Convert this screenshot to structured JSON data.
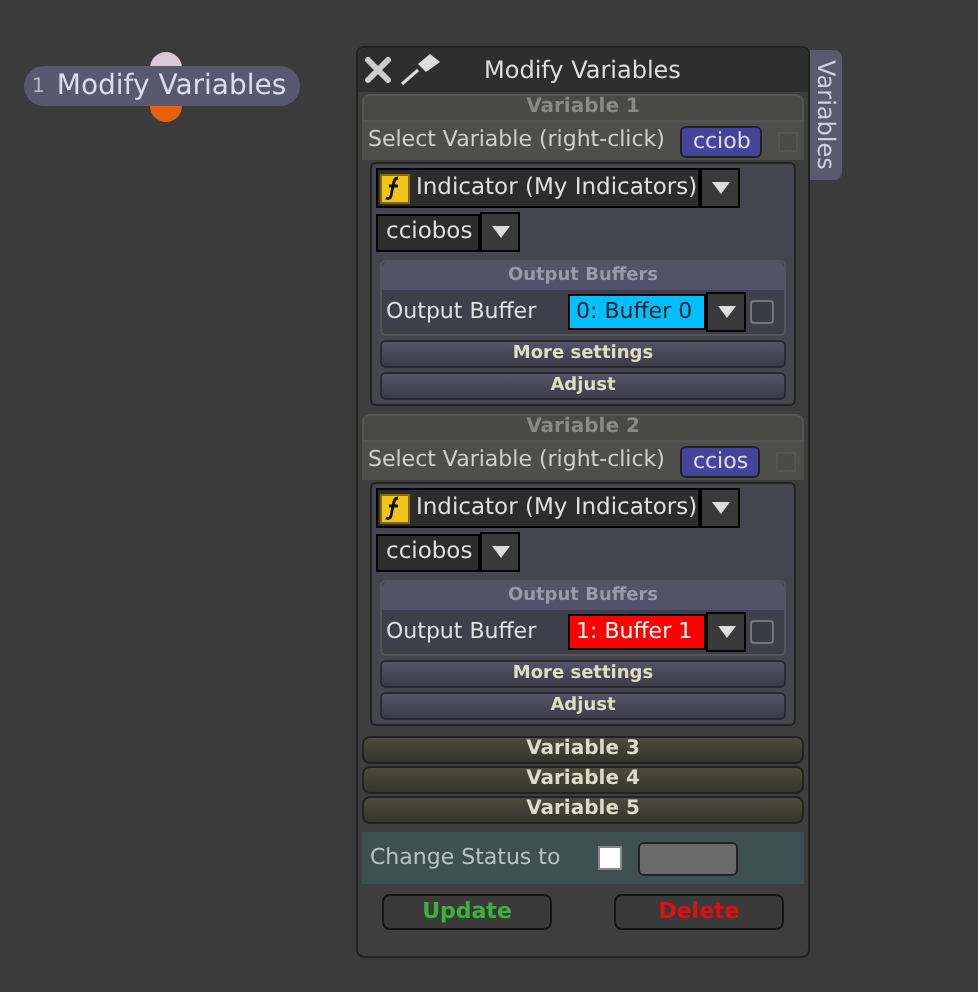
{
  "node": {
    "number": "1",
    "title": "Modify Variables"
  },
  "panel": {
    "title": "Modify Variables",
    "side_tab": "Variables"
  },
  "variables": [
    {
      "header": "Variable 1",
      "expanded": true,
      "select_label": "Select Variable (right-click)",
      "variable_name": "cciob",
      "variable_checked": false,
      "buffer_checked": false,
      "source": "Indicator (My Indicators)",
      "indicator": "cciobos",
      "buffers_title": "Output Buffers",
      "buffer_label": "Output Buffer",
      "buffer": "0: Buffer 0",
      "color": "#00bfff",
      "more": "More settings",
      "adjust": "Adjust"
    },
    {
      "header": "Variable 2",
      "expanded": true,
      "select_label": "Select Variable (right-click)",
      "variable_name": "ccios",
      "variable_checked": false,
      "buffer_checked": false,
      "source": "Indicator (My Indicators)",
      "indicator": "cciobos",
      "buffers_title": "Output Buffers",
      "buffer_label": "Output Buffer",
      "buffer": "1: Buffer 1",
      "color": "#ff0000",
      "more": "More settings",
      "adjust": "Adjust"
    },
    {
      "header": "Variable 3",
      "expanded": false
    },
    {
      "header": "Variable 4",
      "expanded": false
    },
    {
      "header": "Variable 5",
      "expanded": false
    }
  ],
  "status": {
    "label": "Change Status to",
    "checked": false
  },
  "buttons": [
    {
      "label": "Update",
      "kind": "update"
    },
    {
      "label": "Delete",
      "kind": "delete"
    }
  ]
}
